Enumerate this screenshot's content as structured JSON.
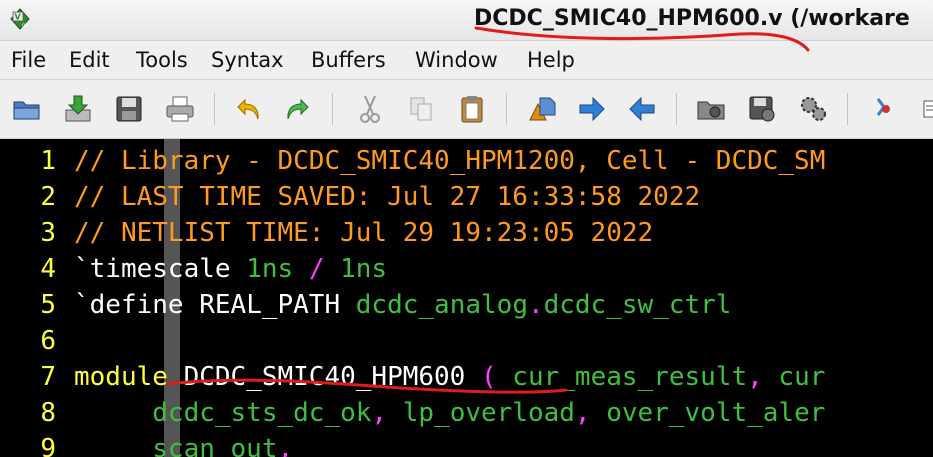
{
  "window": {
    "title": "DCDC_SMIC40_HPM600.v (/workare",
    "app_icon": "vim-icon"
  },
  "menubar": {
    "items": [
      "File",
      "Edit",
      "Tools",
      "Syntax",
      "Buffers",
      "Window",
      "Help"
    ]
  },
  "toolbar": {
    "buttons": [
      {
        "name": "open-icon"
      },
      {
        "name": "save-download-icon"
      },
      {
        "name": "save-icon"
      },
      {
        "name": "print-icon"
      },
      {
        "name": "undo-icon"
      },
      {
        "name": "redo-icon"
      },
      {
        "name": "cut-icon"
      },
      {
        "name": "copy-icon"
      },
      {
        "name": "paste-icon"
      },
      {
        "name": "find-replace-icon"
      },
      {
        "name": "find-next-icon"
      },
      {
        "name": "find-prev-icon"
      },
      {
        "name": "load-session-icon"
      },
      {
        "name": "save-session-icon"
      },
      {
        "name": "run-script-icon"
      },
      {
        "name": "make-icon"
      }
    ]
  },
  "editor": {
    "lines": [
      {
        "num": "1",
        "parts": [
          {
            "t": "// Library - DCDC_SMIC40_HPM1200, Cell - DCDC_SM",
            "c": "comment"
          }
        ]
      },
      {
        "num": "2",
        "parts": [
          {
            "t": "// LAST TIME SAVED: Jul 27 16:33:58 2022",
            "c": "comment"
          }
        ]
      },
      {
        "num": "3",
        "parts": [
          {
            "t": "// NETLIST TIME: Jul 29 19:23:05 2022",
            "c": "comment"
          }
        ]
      },
      {
        "num": "4",
        "parts": [
          {
            "t": "`timescale ",
            "c": "ident"
          },
          {
            "t": "1ns ",
            "c": "green"
          },
          {
            "t": "/",
            "c": "magenta"
          },
          {
            "t": " 1ns",
            "c": "green"
          }
        ]
      },
      {
        "num": "5",
        "parts": [
          {
            "t": "`define ",
            "c": "ident"
          },
          {
            "t": "REAL_PATH ",
            "c": "ident"
          },
          {
            "t": "dcdc_analog",
            "c": "green"
          },
          {
            "t": ".",
            "c": "magenta"
          },
          {
            "t": "dcdc_sw_ctrl",
            "c": "green"
          }
        ]
      },
      {
        "num": "6",
        "parts": []
      },
      {
        "num": "7",
        "parts": [
          {
            "t": "module",
            "c": "kw"
          },
          {
            "t": " DCDC_SMIC40_HPM600 ",
            "c": "ident"
          },
          {
            "t": "(",
            "c": "magenta"
          },
          {
            "t": " cur_meas_result",
            "c": "green"
          },
          {
            "t": ",",
            "c": "magenta"
          },
          {
            "t": " cur",
            "c": "green"
          }
        ]
      },
      {
        "num": "8",
        "parts": [
          {
            "t": "     dcdc_sts_dc_ok",
            "c": "green"
          },
          {
            "t": ",",
            "c": "magenta"
          },
          {
            "t": " lp_overload",
            "c": "green"
          },
          {
            "t": ",",
            "c": "magenta"
          },
          {
            "t": " over_volt_aler",
            "c": "green"
          }
        ]
      },
      {
        "num": "9",
        "parts": [
          {
            "t": "     scan_out",
            "c": "green"
          },
          {
            "t": ",",
            "c": "magenta"
          }
        ]
      }
    ]
  }
}
